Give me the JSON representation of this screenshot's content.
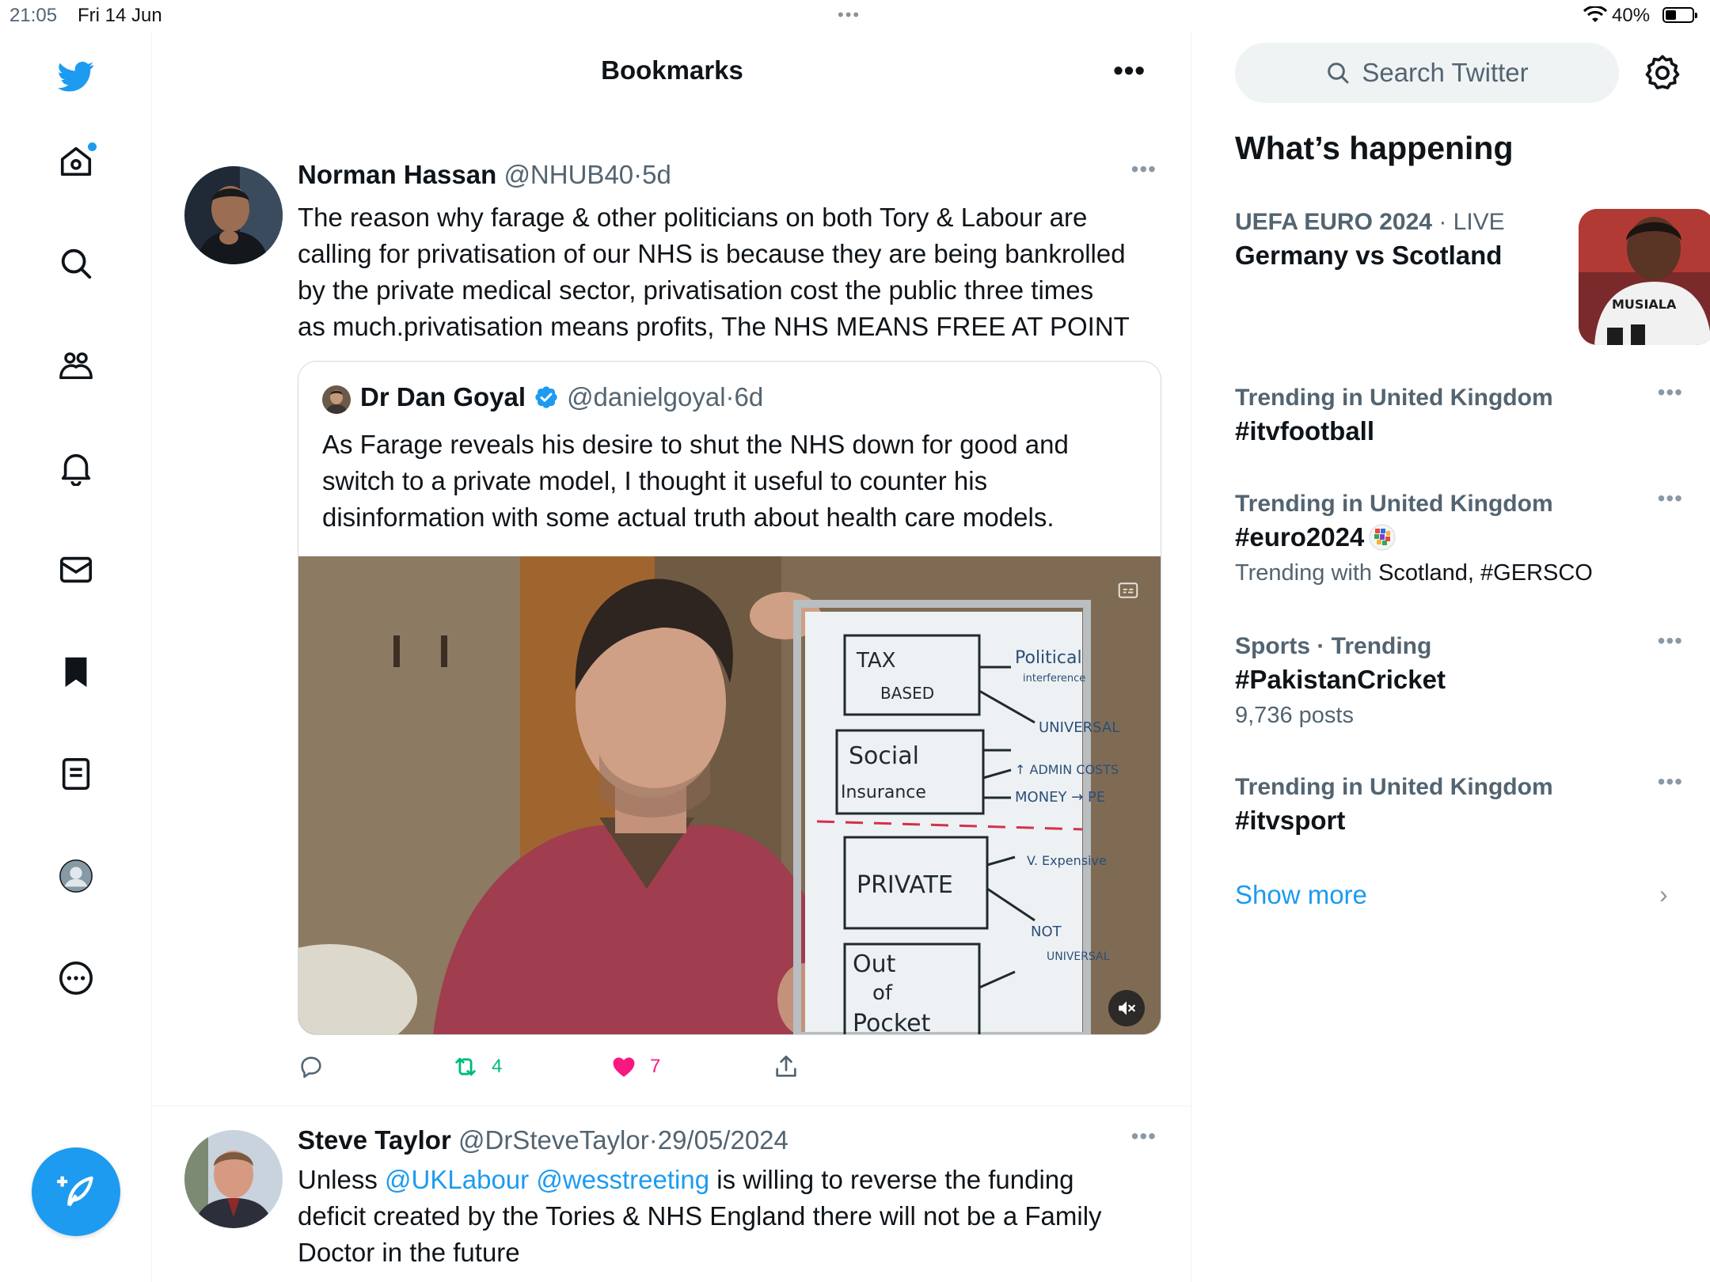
{
  "status_bar": {
    "time": "21:05",
    "date": "Fri 14 Jun",
    "battery": "40%"
  },
  "header": {
    "title": "Bookmarks",
    "more": "•••"
  },
  "tweets": [
    {
      "author": "Norman Hassan",
      "handle": "@NHUB40",
      "sep": "·",
      "time": "5d",
      "text": "The reason why farage & other politicians on both Tory & Labour are\ncalling for privatisation of our NHS is because they are being bankrolled\nby the private medical sector, privatisation cost the public three times\nas much.privatisation means profits, The NHS MEANS FREE AT POINT",
      "quote": {
        "author": "Dr Dan Goyal",
        "handle": "@danielgoyal",
        "sep": "·",
        "time": "6d",
        "text": "As Farage reveals his desire to shut the NHS down for good and\nswitch to a private model, I thought it useful to counter his\ndisinformation with some actual truth about health care models."
      },
      "whiteboard": {
        "box1": [
          "TAX",
          "BASED"
        ],
        "box2": [
          "Social",
          "Insurance"
        ],
        "box3": [
          "PRIVATE"
        ],
        "box4": [
          "Out",
          "of",
          "Pocket"
        ],
        "notes": [
          "Political",
          "interference",
          "UNIVERSAL",
          "↑ ADMIN COSTS",
          "MONEY → PE",
          "V. Expensive",
          "NOT",
          "UNIVERSAL"
        ]
      },
      "retweets": "4",
      "likes": "7",
      "more": "•••"
    },
    {
      "author": "Steve Taylor",
      "handle": "@DrSteveTaylor",
      "sep": "·",
      "time": "29/05/2024",
      "text_prefix": "Unless ",
      "mention1": "@UKLabour",
      "mention2": "@wesstreeting",
      "text_rest": " is willing to reverse the funding\ndeficit created by the Tories & NHS England there will not be a Family\nDoctor in the future",
      "more": "•••"
    }
  ],
  "sidebar": {
    "search_placeholder": "Search Twitter",
    "trends_title": "What’s happening",
    "trends": [
      {
        "meta": "UEFA EURO 2024",
        "meta_sep": " · ",
        "meta_extra": "LIVE",
        "name": "Germany vs Scotland",
        "thumb_text": "MUSIALA"
      },
      {
        "meta": "Trending in United Kingdom",
        "name": "#itvfootball",
        "more": "•••"
      },
      {
        "meta": "Trending in United Kingdom",
        "name": "#euro2024",
        "sub_prefix": "Trending with ",
        "sub_value": "Scotland, #GERSCO",
        "more": "•••"
      },
      {
        "meta": "Sports · Trending",
        "name": "#PakistanCricket",
        "sub": "9,736 posts",
        "more": "•••"
      },
      {
        "meta": "Trending in United Kingdom",
        "name": "#itvsport",
        "more": "•••"
      }
    ],
    "show_more": "Show more",
    "chevron": "›"
  },
  "colors": {
    "accent": "#1d9bf0",
    "retweet": "#00ba7c",
    "like": "#f91880",
    "secondary_text": "#536471"
  },
  "icons": [
    "twitter-logo-icon",
    "home-icon",
    "search-icon",
    "communities-icon",
    "notifications-icon",
    "messages-icon",
    "bookmark-icon",
    "lists-icon",
    "profile-icon",
    "more-icon",
    "compose-icon",
    "settings-icon",
    "verified-icon",
    "reply-icon",
    "retweet-icon",
    "like-icon",
    "share-icon",
    "mute-icon"
  ]
}
